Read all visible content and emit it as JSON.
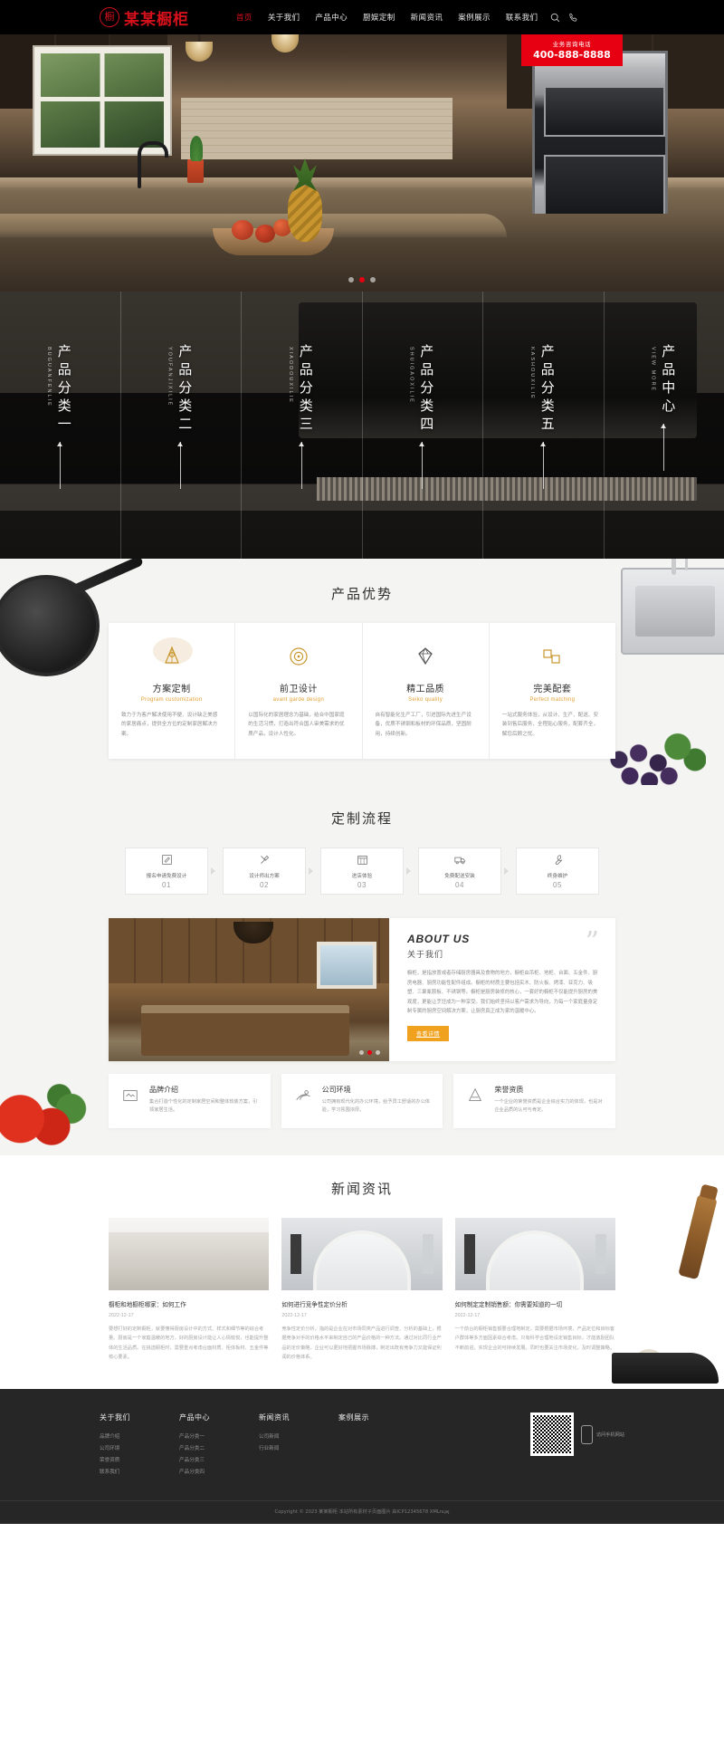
{
  "header": {
    "logo_mark": "橱",
    "logo_text": "某某橱柜",
    "nav": [
      {
        "label": "首页",
        "active": true
      },
      {
        "label": "关于我们",
        "active": false
      },
      {
        "label": "产品中心",
        "active": false
      },
      {
        "label": "厨娱定制",
        "active": false
      },
      {
        "label": "新闻资讯",
        "active": false
      },
      {
        "label": "案例展示",
        "active": false
      },
      {
        "label": "联系我们",
        "active": false
      }
    ],
    "search_icon": "search-icon",
    "phone_icon": "phone-icon",
    "phone_box": {
      "label": "业务咨询电话",
      "number": "400-888-8888",
      "bg_color": "#e60012"
    }
  },
  "hero": {
    "alt": "现代开放式厨房实景图",
    "slides_total": 3,
    "active_slide": 2,
    "dot_active_color": "#e60012"
  },
  "categories": [
    {
      "cn": "产品分类一",
      "py": "BUGUANFENLIE"
    },
    {
      "cn": "产品分类二",
      "py": "YOUFANJIXILIE"
    },
    {
      "cn": "产品分类三",
      "py": "XIAODOUXILIE"
    },
    {
      "cn": "产品分类四",
      "py": "SHUIGAOXILIE"
    },
    {
      "cn": "产品分类五",
      "py": "KASHOUXILIE"
    },
    {
      "cn": "产品中心",
      "py": "VIEW MORE"
    }
  ],
  "advantages": {
    "title": "产品优势",
    "cards": [
      {
        "icon": "custom-plan-icon",
        "cn": "方案定制",
        "en": "Program customization",
        "desc": "致力于为客户解决使用不便、设计缺乏美感的家居痛点，提供全方位的定制家居解决方案。"
      },
      {
        "icon": "target-design-icon",
        "cn": "前卫设计",
        "en": "avant garde design",
        "desc": "以国际化的家居理念为基础，结合中国家庭的生活习惯，打造出符合国人审美需求的优质产品，设计人性化。"
      },
      {
        "icon": "diamond-quality-icon",
        "cn": "精工品质",
        "en": "Seiko quality",
        "desc": "自有智能化生产工厂，引进国际先进生产设备，优质不锈钢和板材的环保品质，坚固耐用，持续创新。"
      },
      {
        "icon": "perfect-match-icon",
        "cn": "完美配套",
        "en": "Perfect matching",
        "desc": "一站式服务体验，从设计、生产、配送、安装到售后服务，全程贴心服务，配套齐全，解您后顾之忧。"
      }
    ]
  },
  "process": {
    "title": "定制流程",
    "steps": [
      {
        "icon": "pencil-icon",
        "label": "报名申请免费设计",
        "num": "01"
      },
      {
        "icon": "tools-icon",
        "label": "设计师出方案",
        "num": "02"
      },
      {
        "icon": "calendar-icon",
        "label": "进店体验",
        "num": "03"
      },
      {
        "icon": "truck-icon",
        "label": "免费配送安装",
        "num": "04"
      },
      {
        "icon": "wrench-icon",
        "label": "终身维护",
        "num": "05"
      }
    ]
  },
  "about": {
    "en_title": "ABOUT US",
    "cn_title": "关于我们",
    "quote_mark": "”",
    "body": "橱柜，是指放置或者存储厨房器具及食物的地方，橱柜由吊柜、地柜、台面、五金件、厨房电器、厨房功能性配件组成。橱柜的材质主要包括实木、防火板、烤漆、亚克力、吸塑、三聚氰胺板、不锈钢等。橱柜是厨房装修的核心，一套好的橱柜不仅能提升厨房的美观度，更能让烹饪成为一种享受。我们始终坚持以客户需求为导向，为每一个家庭量身定制专属的厨房空间解决方案，让厨房真正成为家的温暖中心。",
    "btn": "查看详情",
    "image_alt": "木质橱柜厨房实景",
    "slides_total": 3,
    "active_slide": 2,
    "features": [
      {
        "icon": "brand-icon",
        "title": "品牌介绍",
        "desc": "集合打造个性化的定制家居空间和整体软装方案，引领家居生活。"
      },
      {
        "icon": "company-icon",
        "title": "公司环境",
        "desc": "公司拥有现代化的办公环境，给予员工舒适的办公体验，学习氛围浓厚。"
      },
      {
        "icon": "honor-icon",
        "title": "荣誉资质",
        "desc": "一个企业的荣誉资质是企业综合实力的体现，也是对企业品质的认可与肯定。"
      }
    ]
  },
  "news": {
    "title": "新闻资讯",
    "items": [
      {
        "title": "橱柜和地橱柜哪家：如何工作",
        "date": "2022-12-17",
        "excerpt": "要想打好的定制橱柜，就要懂得厨房设计中的方式、样式和细节等的综合考量。厨房是一个家庭温暖的地方，好的厨房设计能让人心情愉悦，也能提升整体的生活品质。在挑选橱柜时，需要重点考虑台面材质、柜体板材、五金件等核心要素。"
      },
      {
        "title": "如何进行竞争性定价分析",
        "date": "2022-12-17",
        "excerpt": "竞争性定价分析，指的是企业在对市场同类产品进行调查、分析的基础上，根据竞争对手的价格水平来制定自己的产品价格的一种方法。通过对比同行业产品的定价策略，企业可以更好地把握市场脉搏，制定出既有竞争力又能保证利润的价格体系。"
      },
      {
        "title": "如何制定定制销售额：你需要知道的一切",
        "date": "2022-12-17",
        "excerpt": "一个前台的橱柜销售额要合理地制定，需要根据市场环境、产品定位和目标客户群体等多方面因素综合考虑。只有科学合理地设定销售目标，才能激励团队不断前进，实现企业的可持续发展。同时也要关注市场变化，及时调整策略。"
      }
    ]
  },
  "footer": {
    "columns": [
      {
        "heading": "关于我们",
        "links": [
          "品牌介绍",
          "公司环境",
          "荣誉资质",
          "联系我们"
        ]
      },
      {
        "heading": "产品中心",
        "links": [
          "产品分类一",
          "产品分类二",
          "产品分类三",
          "产品分类四"
        ]
      },
      {
        "heading": "新闻资讯",
        "links": [
          "公司新闻",
          "行业新闻"
        ]
      },
      {
        "heading": "案例展示",
        "links": []
      }
    ],
    "qr": {
      "caption": "访问手机网站",
      "phone_icon": "mobile-phone-icon"
    },
    "copyright": "Copyright © 2023 某某橱柜 本站所有素材子页面图片 由ICP12345678  XMLությ"
  }
}
